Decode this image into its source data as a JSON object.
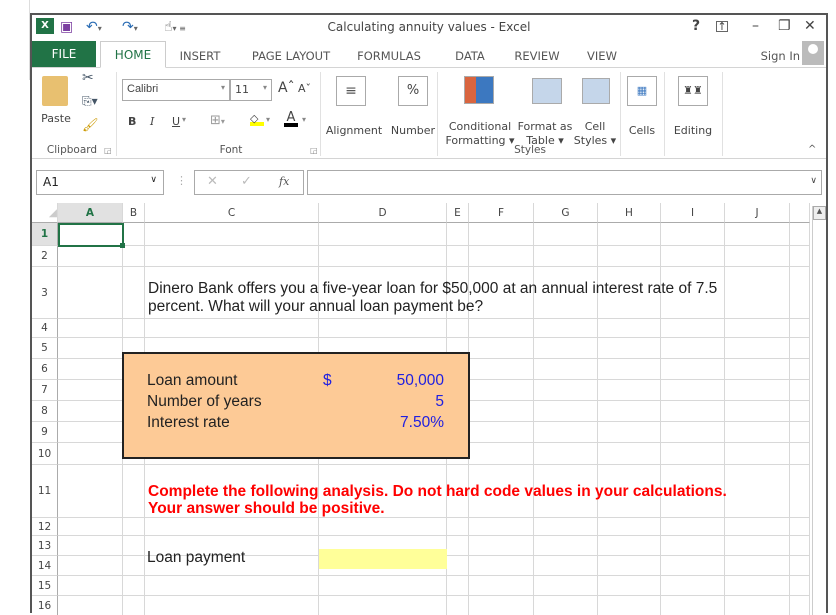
{
  "window": {
    "title": "Calculating annuity values - Excel",
    "help": "?",
    "sign_in": "Sign In"
  },
  "tabs": [
    "FILE",
    "HOME",
    "INSERT",
    "PAGE LAYOUT",
    "FORMULAS",
    "DATA",
    "REVIEW",
    "VIEW"
  ],
  "ribbon": {
    "clipboard": {
      "paste": "Paste",
      "group": "Clipboard"
    },
    "font": {
      "name": "Calibri",
      "size": "11",
      "bold": "B",
      "italic": "I",
      "underline": "U",
      "font_color": "A",
      "group": "Font"
    },
    "alignment": "Alignment",
    "number": "Number",
    "number_icon": "%",
    "conditional": [
      "Conditional",
      "Formatting ▾"
    ],
    "format_table": [
      "Format as",
      "Table ▾"
    ],
    "cell_styles": [
      "Cell",
      "Styles ▾"
    ],
    "styles_group": "Styles",
    "cells": "Cells",
    "editing": "Editing"
  },
  "formula_bar": {
    "name_box": "A1",
    "fx": "fx",
    "cancel": "✕",
    "enter": "✓",
    "value": ""
  },
  "columns": [
    "A",
    "B",
    "C",
    "D",
    "E",
    "F",
    "G",
    "H",
    "I",
    "J"
  ],
  "rows": [
    "1",
    "2",
    "3",
    "4",
    "5",
    "6",
    "7",
    "8",
    "9",
    "10",
    "11",
    "12",
    "13",
    "14",
    "15",
    "16"
  ],
  "selected_cell": "A1",
  "sheet": {
    "question": [
      "Dinero Bank offers you a five-year loan for $50,000 at an annual interest rate of 7.5",
      "percent. What will your annual loan payment be?"
    ],
    "inputs": [
      {
        "label": "Loan amount",
        "currency": "$",
        "value": "50,000"
      },
      {
        "label": "Number of years",
        "value": "5"
      },
      {
        "label": "Interest rate",
        "value": "7.50%"
      }
    ],
    "instruction": [
      "Complete the following analysis. Do not hard code values in your calculations.",
      "Your answer should be positive."
    ],
    "loan_payment_label": "Loan payment",
    "loan_payment_value": ""
  },
  "colors": {
    "excel_green": "#217346",
    "input_box": "#fdca96",
    "answer_cell": "#ffff99",
    "input_text": "#2020e0",
    "instruction_text": "#ff0000"
  }
}
